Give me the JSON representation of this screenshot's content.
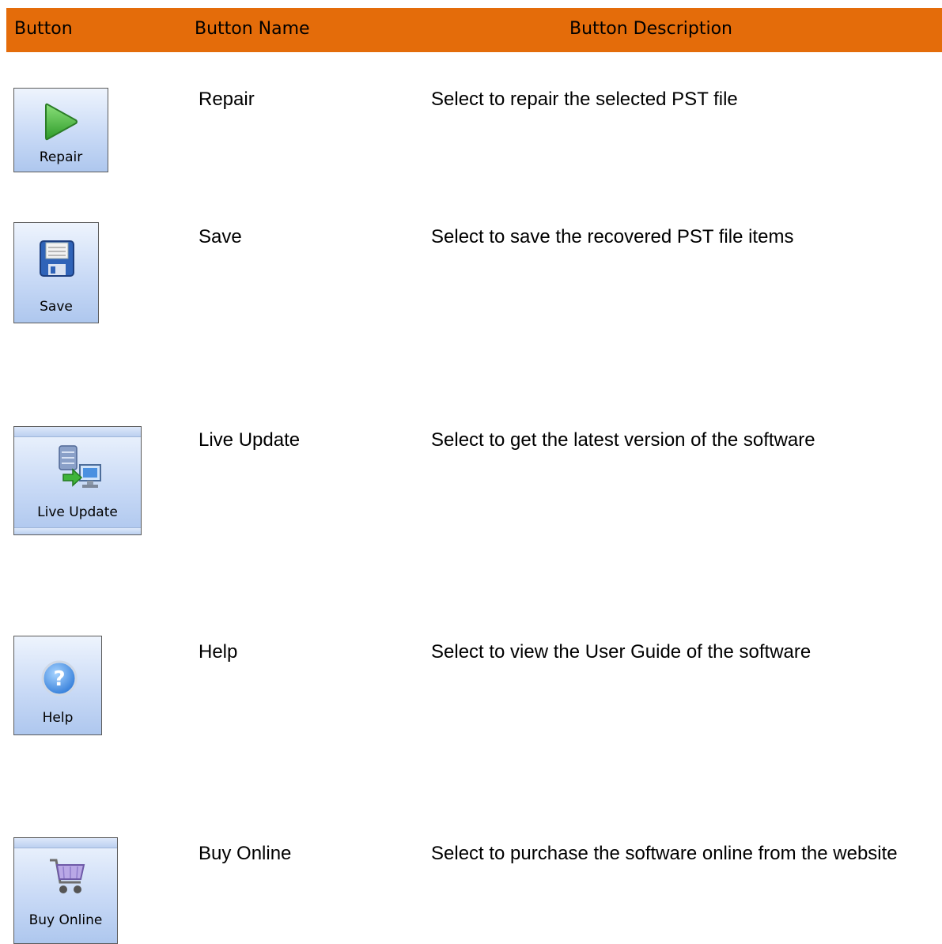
{
  "header": {
    "col_button": "Button",
    "col_name": "Button Name",
    "col_description": "Button Description",
    "bg_color": "#e46c0a"
  },
  "rows": [
    {
      "icon": "play-icon",
      "button_label": "Repair",
      "name": "Repair",
      "description": "Select to repair the selected PST file"
    },
    {
      "icon": "floppy-disk-icon",
      "button_label": "Save",
      "name": "Save",
      "description": "Select to save the recovered PST file items"
    },
    {
      "icon": "server-computer-update-icon",
      "button_label": "Live Update",
      "name": "Live Update",
      "description": "Select to get the latest version of the software"
    },
    {
      "icon": "question-mark-icon",
      "button_label": "Help",
      "name": "Help",
      "description": "Select to view the User Guide of the software"
    },
    {
      "icon": "shopping-cart-icon",
      "button_label": "Buy Online",
      "name": "Buy Online",
      "description": "Select to purchase the software online from the website"
    }
  ]
}
